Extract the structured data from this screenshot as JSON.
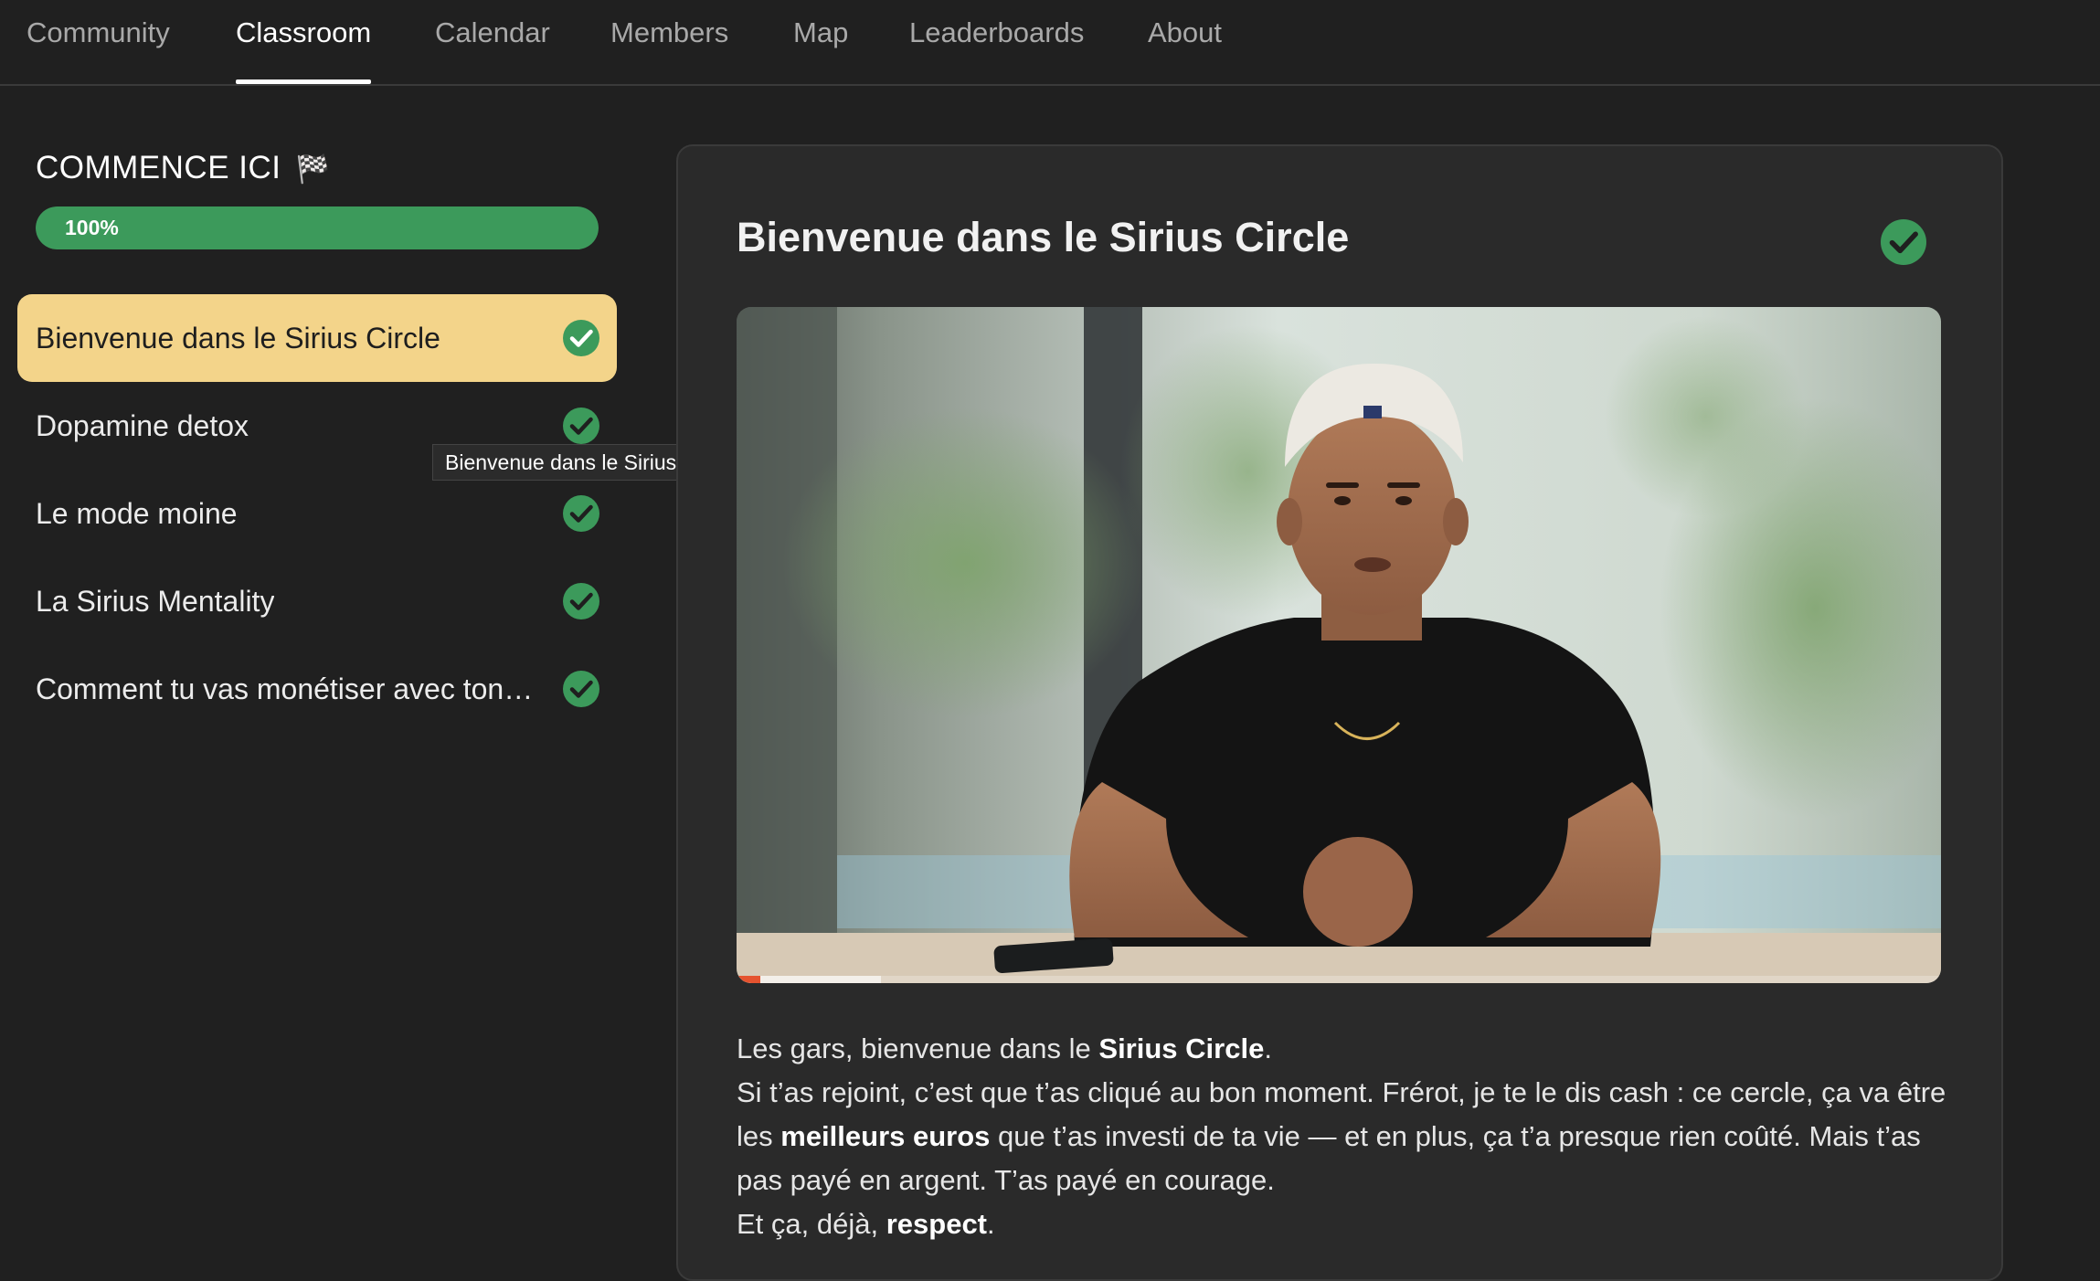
{
  "nav": {
    "tabs": [
      {
        "label": "Community",
        "active": false
      },
      {
        "label": "Classroom",
        "active": true
      },
      {
        "label": "Calendar",
        "active": false
      },
      {
        "label": "Members",
        "active": false
      },
      {
        "label": "Map",
        "active": false
      },
      {
        "label": "Leaderboards",
        "active": false
      },
      {
        "label": "About",
        "active": false
      }
    ]
  },
  "sidebar": {
    "course_title": "COMMENCE ICI",
    "flag_icon": "🏁",
    "progress_percent": 100,
    "progress_label": "100%",
    "lessons": [
      {
        "label": "Bienvenue dans le Sirius Circle",
        "completed": true,
        "active": true
      },
      {
        "label": "Dopamine detox",
        "completed": true,
        "active": false
      },
      {
        "label": "Le mode moine",
        "completed": true,
        "active": false
      },
      {
        "label": "La Sirius Mentality",
        "completed": true,
        "active": false
      },
      {
        "label": "Comment tu vas monétiser avec ton…",
        "completed": true,
        "active": false
      }
    ],
    "tooltip": "Bienvenue dans le Sirius Circle"
  },
  "main": {
    "title": "Bienvenue dans le Sirius Circle",
    "completed": true,
    "video": {
      "played_fraction": 0.02,
      "buffered_fraction": 0.12
    },
    "paragraphs": {
      "p1_a": "Les gars, bienvenue dans le ",
      "p1_b": "Sirius Circle",
      "p1_c": ".",
      "p2_a": "Si t’as rejoint, c’est que t’as cliqué au bon moment. Frérot, je te le dis cash : ce cercle, ça va être les ",
      "p2_b": "meilleurs euros",
      "p2_c": " que t’as investi de ta vie — et en plus, ça t’a presque rien coûté. Mais t’as pas payé en argent. T’as payé en courage.",
      "p3_a": "Et ça, déjà, ",
      "p3_b": "respect",
      "p3_c": "."
    }
  },
  "colors": {
    "accent_green": "#3c9a5b",
    "active_lesson_bg": "#f3d48a",
    "video_progress": "#e5532f"
  }
}
